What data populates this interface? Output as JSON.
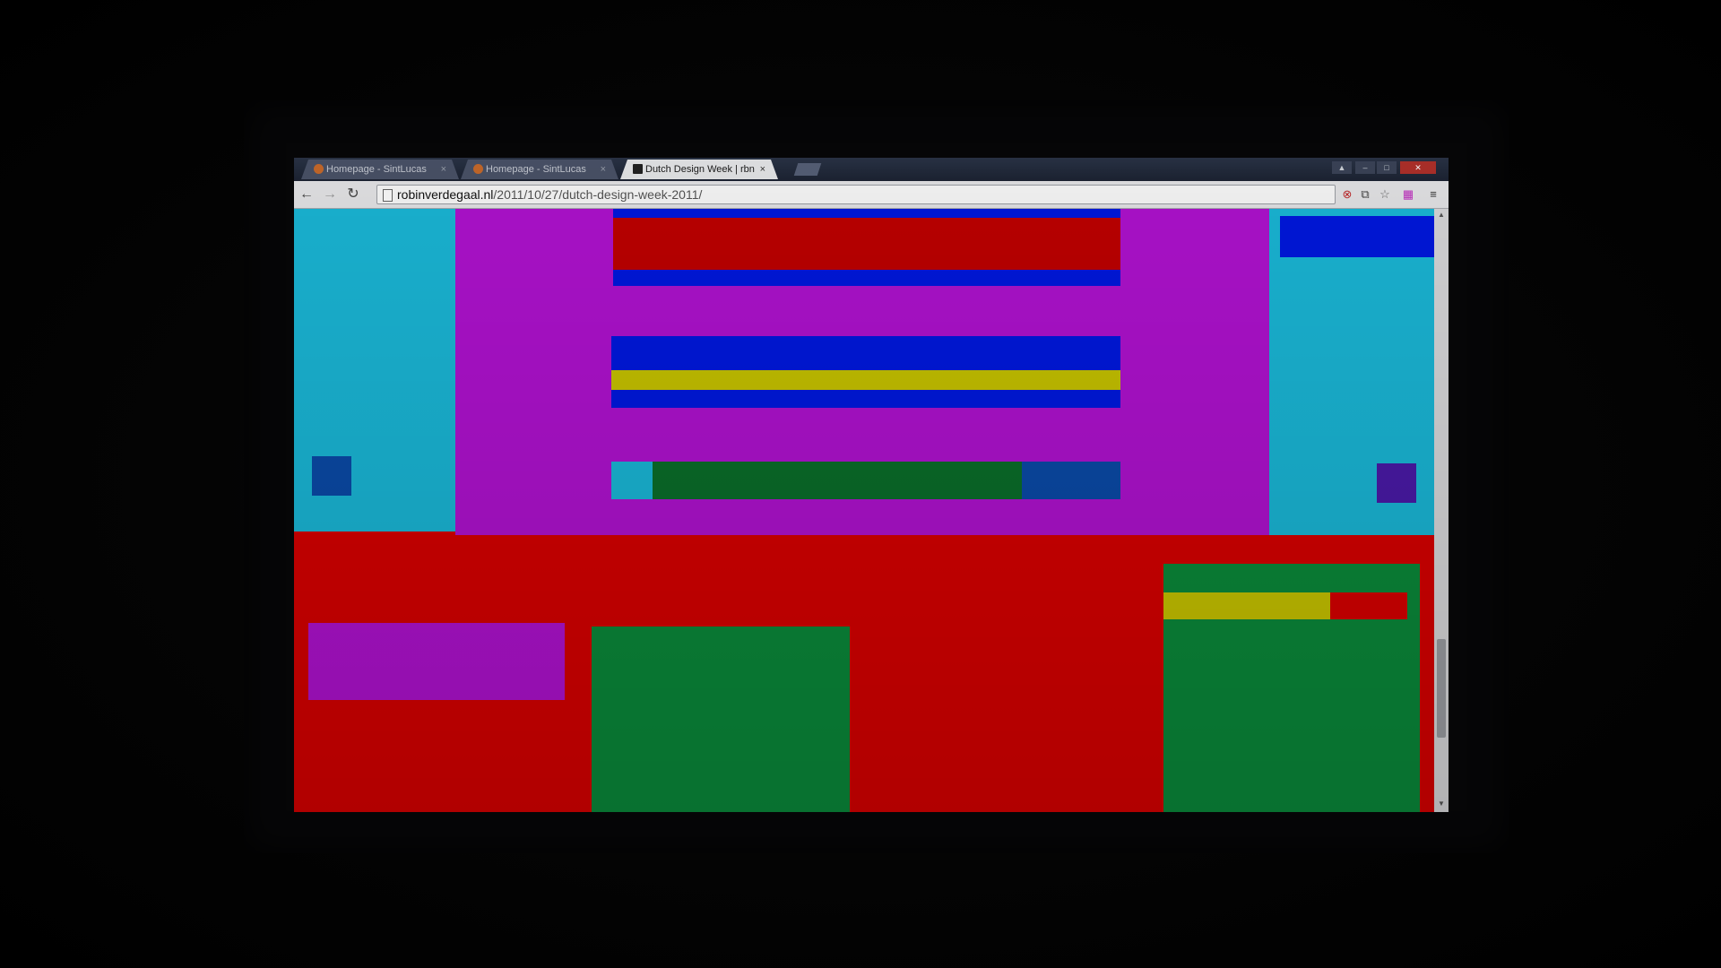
{
  "browser": {
    "tabs": [
      {
        "label": "Homepage - SintLucas",
        "active": false
      },
      {
        "label": "Homepage - SintLucas",
        "active": false
      },
      {
        "label": "Dutch Design Week | rbn",
        "active": true
      }
    ],
    "close_glyph": "×",
    "url": {
      "host": "robinverdegaal.nl",
      "path": "/2011/10/27/dutch-design-week-2011/"
    },
    "toolbar_icons": [
      "back-icon",
      "forward-icon",
      "reload-icon",
      "page-icon",
      "adblock-icon",
      "translate-icon",
      "star-icon",
      "extension-icon",
      "menu-icon"
    ]
  },
  "artwork": {
    "colors": {
      "red": "#d80000",
      "magenta": "#b012d0",
      "cyan": "#1ab8d8",
      "blue": "#0018e0",
      "dark_blue": "#0a4aa8",
      "yellow": "#c8c400",
      "green": "#0a8a3a",
      "dark_green": "#0a6e2a",
      "purple": "#4a1aa8",
      "crimson": "#b8000a"
    }
  }
}
